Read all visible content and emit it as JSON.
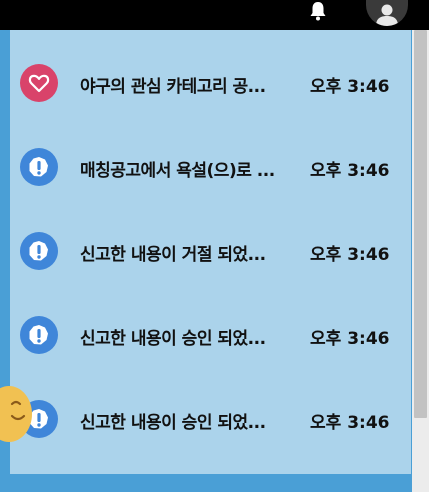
{
  "colors": {
    "panel_bg": "#abd3eb",
    "frame_bg": "#4a9fd6",
    "topbar_bg": "#000000",
    "like_icon_bg": "#d9436a",
    "alert_icon_bg": "#3f86d9"
  },
  "topbar": {
    "icons": [
      "bell-icon",
      "user-avatar"
    ]
  },
  "notifications": [
    {
      "icon": "heart-icon",
      "text": "야구의 관심 카테고리 공...",
      "time": "오후 3:46"
    },
    {
      "icon": "exclamation-icon",
      "text": "매칭공고에서 욕설(으)로 ...",
      "time": "오후 3:46"
    },
    {
      "icon": "exclamation-icon",
      "text": "신고한 내용이 거절 되었...",
      "time": "오후 3:46"
    },
    {
      "icon": "exclamation-icon",
      "text": "신고한 내용이 승인 되었...",
      "time": "오후 3:46"
    },
    {
      "icon": "exclamation-icon",
      "text": "신고한 내용이 승인 되었...",
      "time": "오후 3:46"
    }
  ]
}
